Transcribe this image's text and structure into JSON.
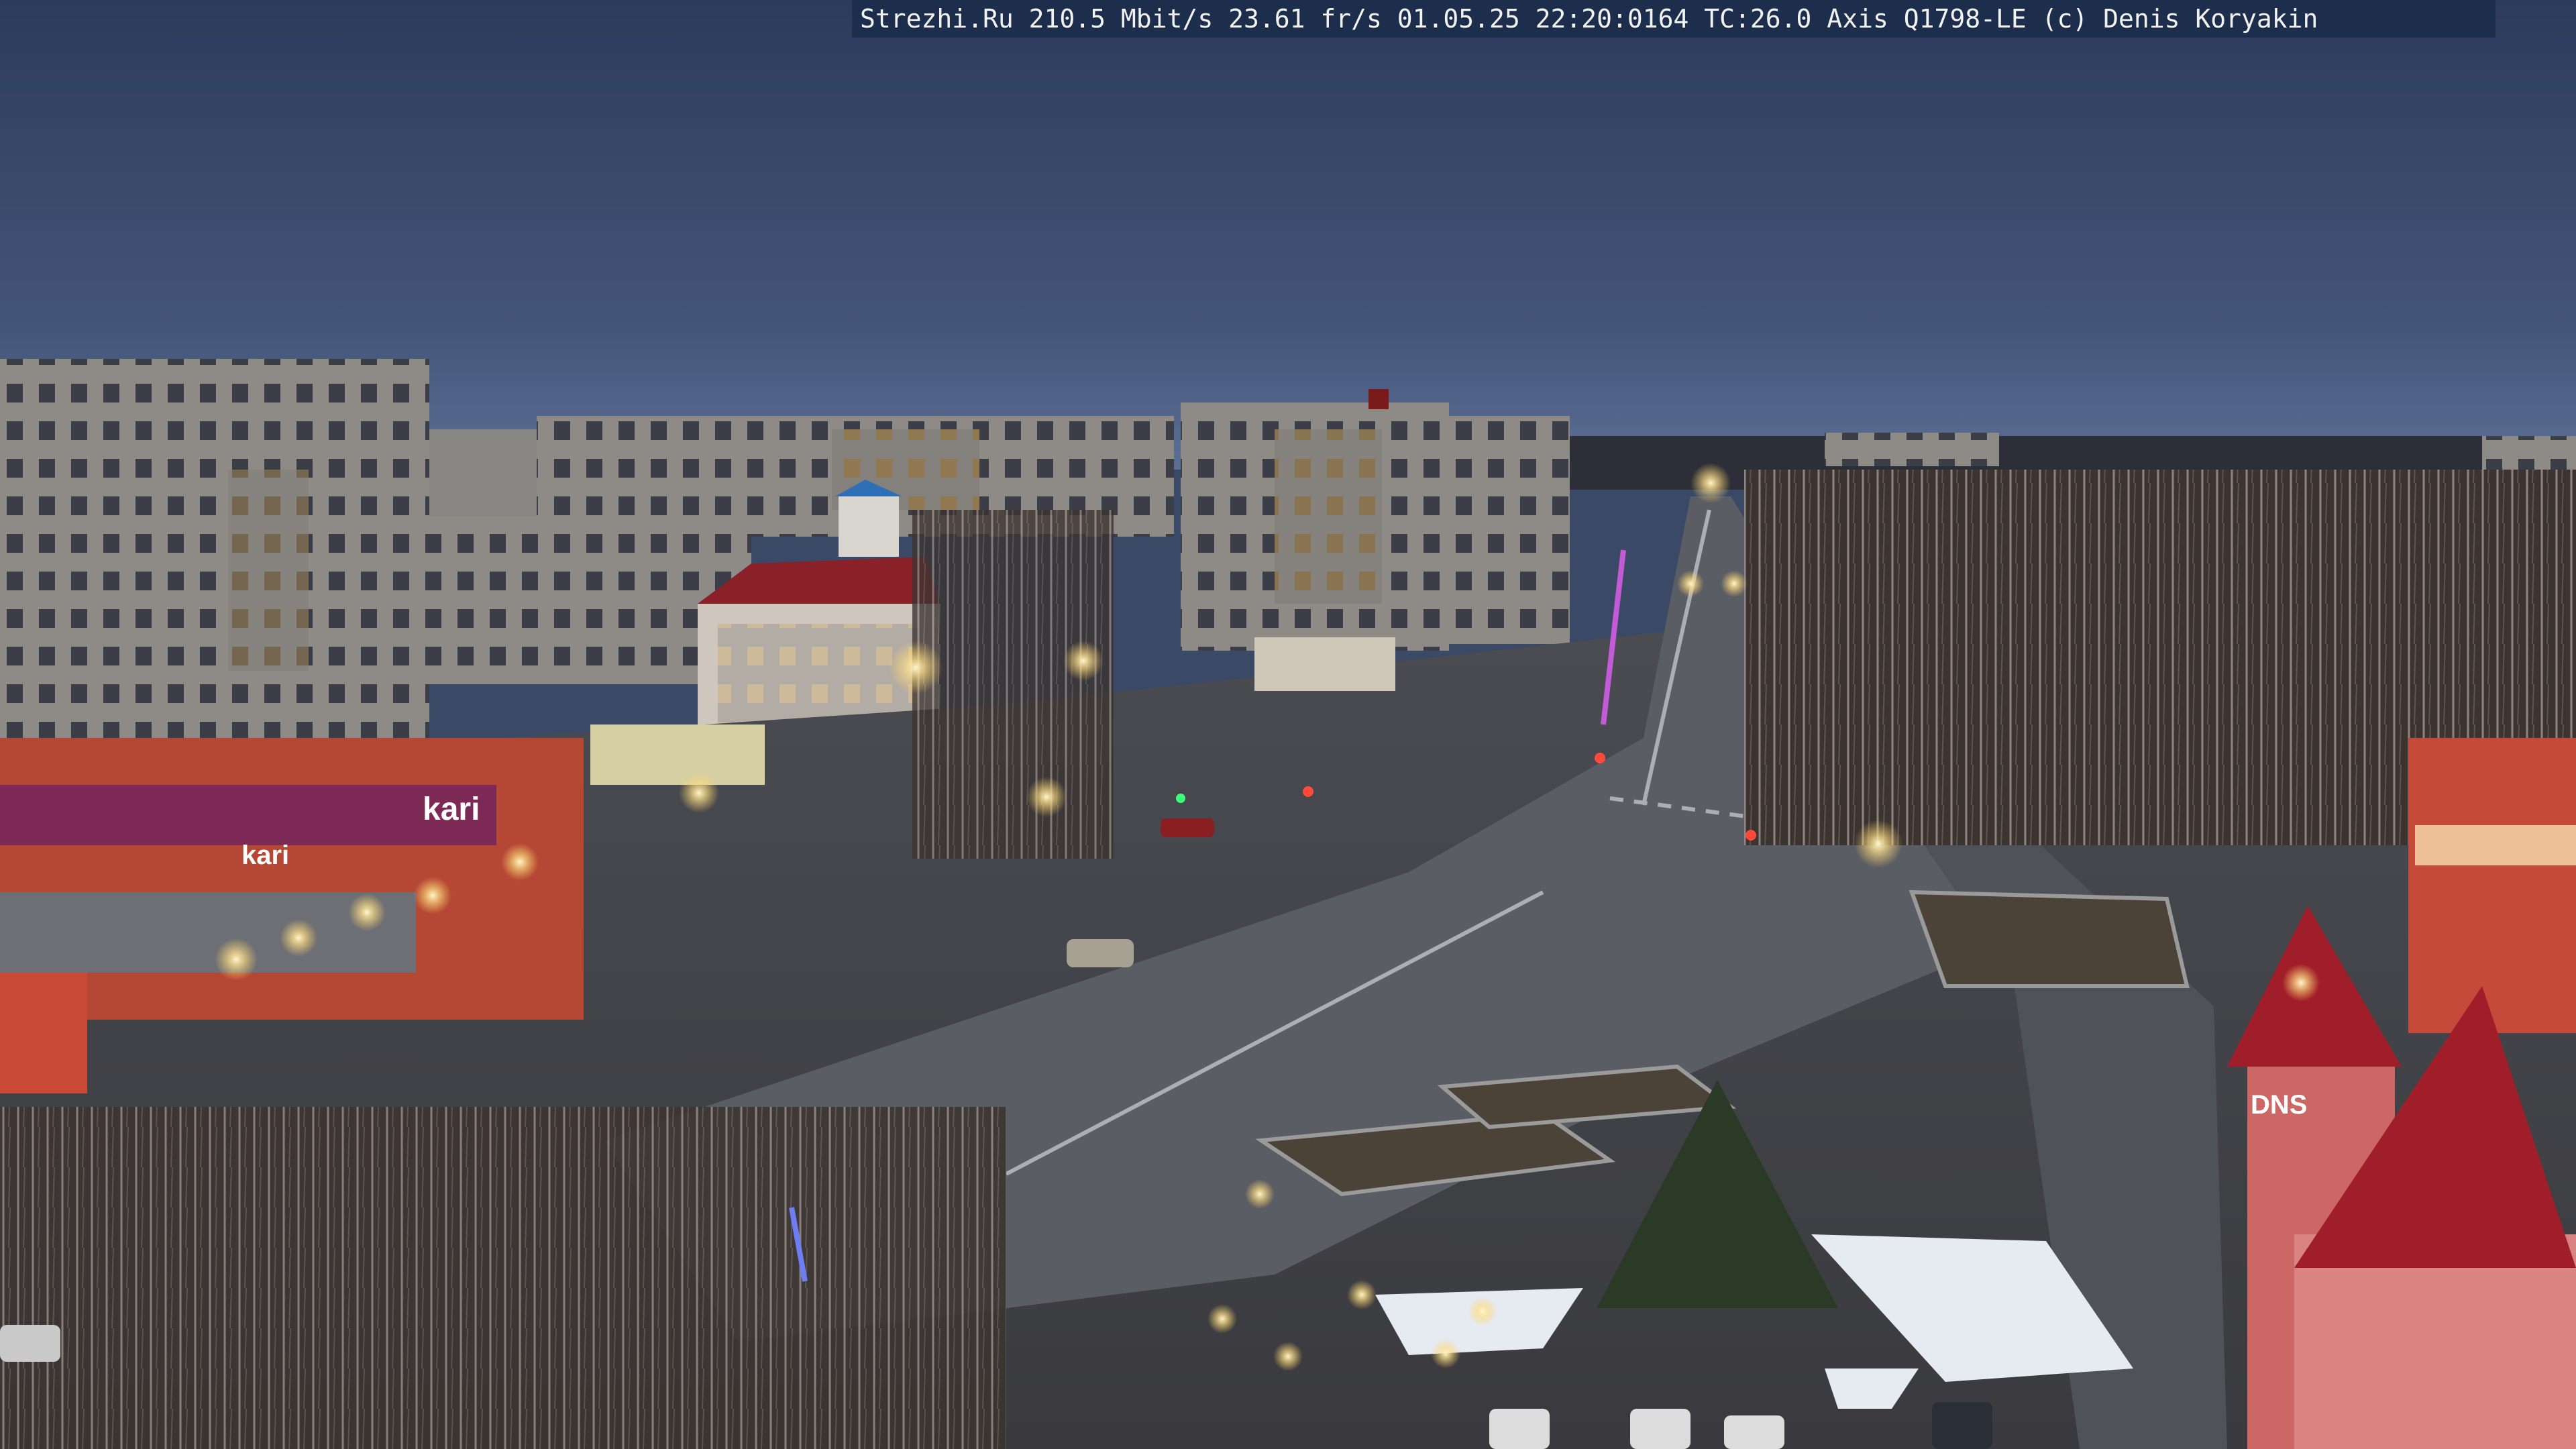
{
  "camera_overlay": {
    "text": "Strezhi.Ru 210.5 Mbit/s 23.61 fr/s 01.05.25 22:20:0164 TC:26.0  Axis Q1798-LE  (c) Denis Koryakin"
  },
  "signs": {
    "kari_big": "kari",
    "kari_small": "kari",
    "dns": "DNS"
  },
  "colors": {
    "sky_top": "#2e3d5e",
    "sky_horizon": "#5a6e92",
    "road": "#55585f",
    "panel_building": "#9a958f",
    "red_roof": "#a01e2a",
    "storefront": "#b94a36",
    "lamp_glow": "#ffe9a8",
    "overlay_bg": "#1d2d4c"
  }
}
